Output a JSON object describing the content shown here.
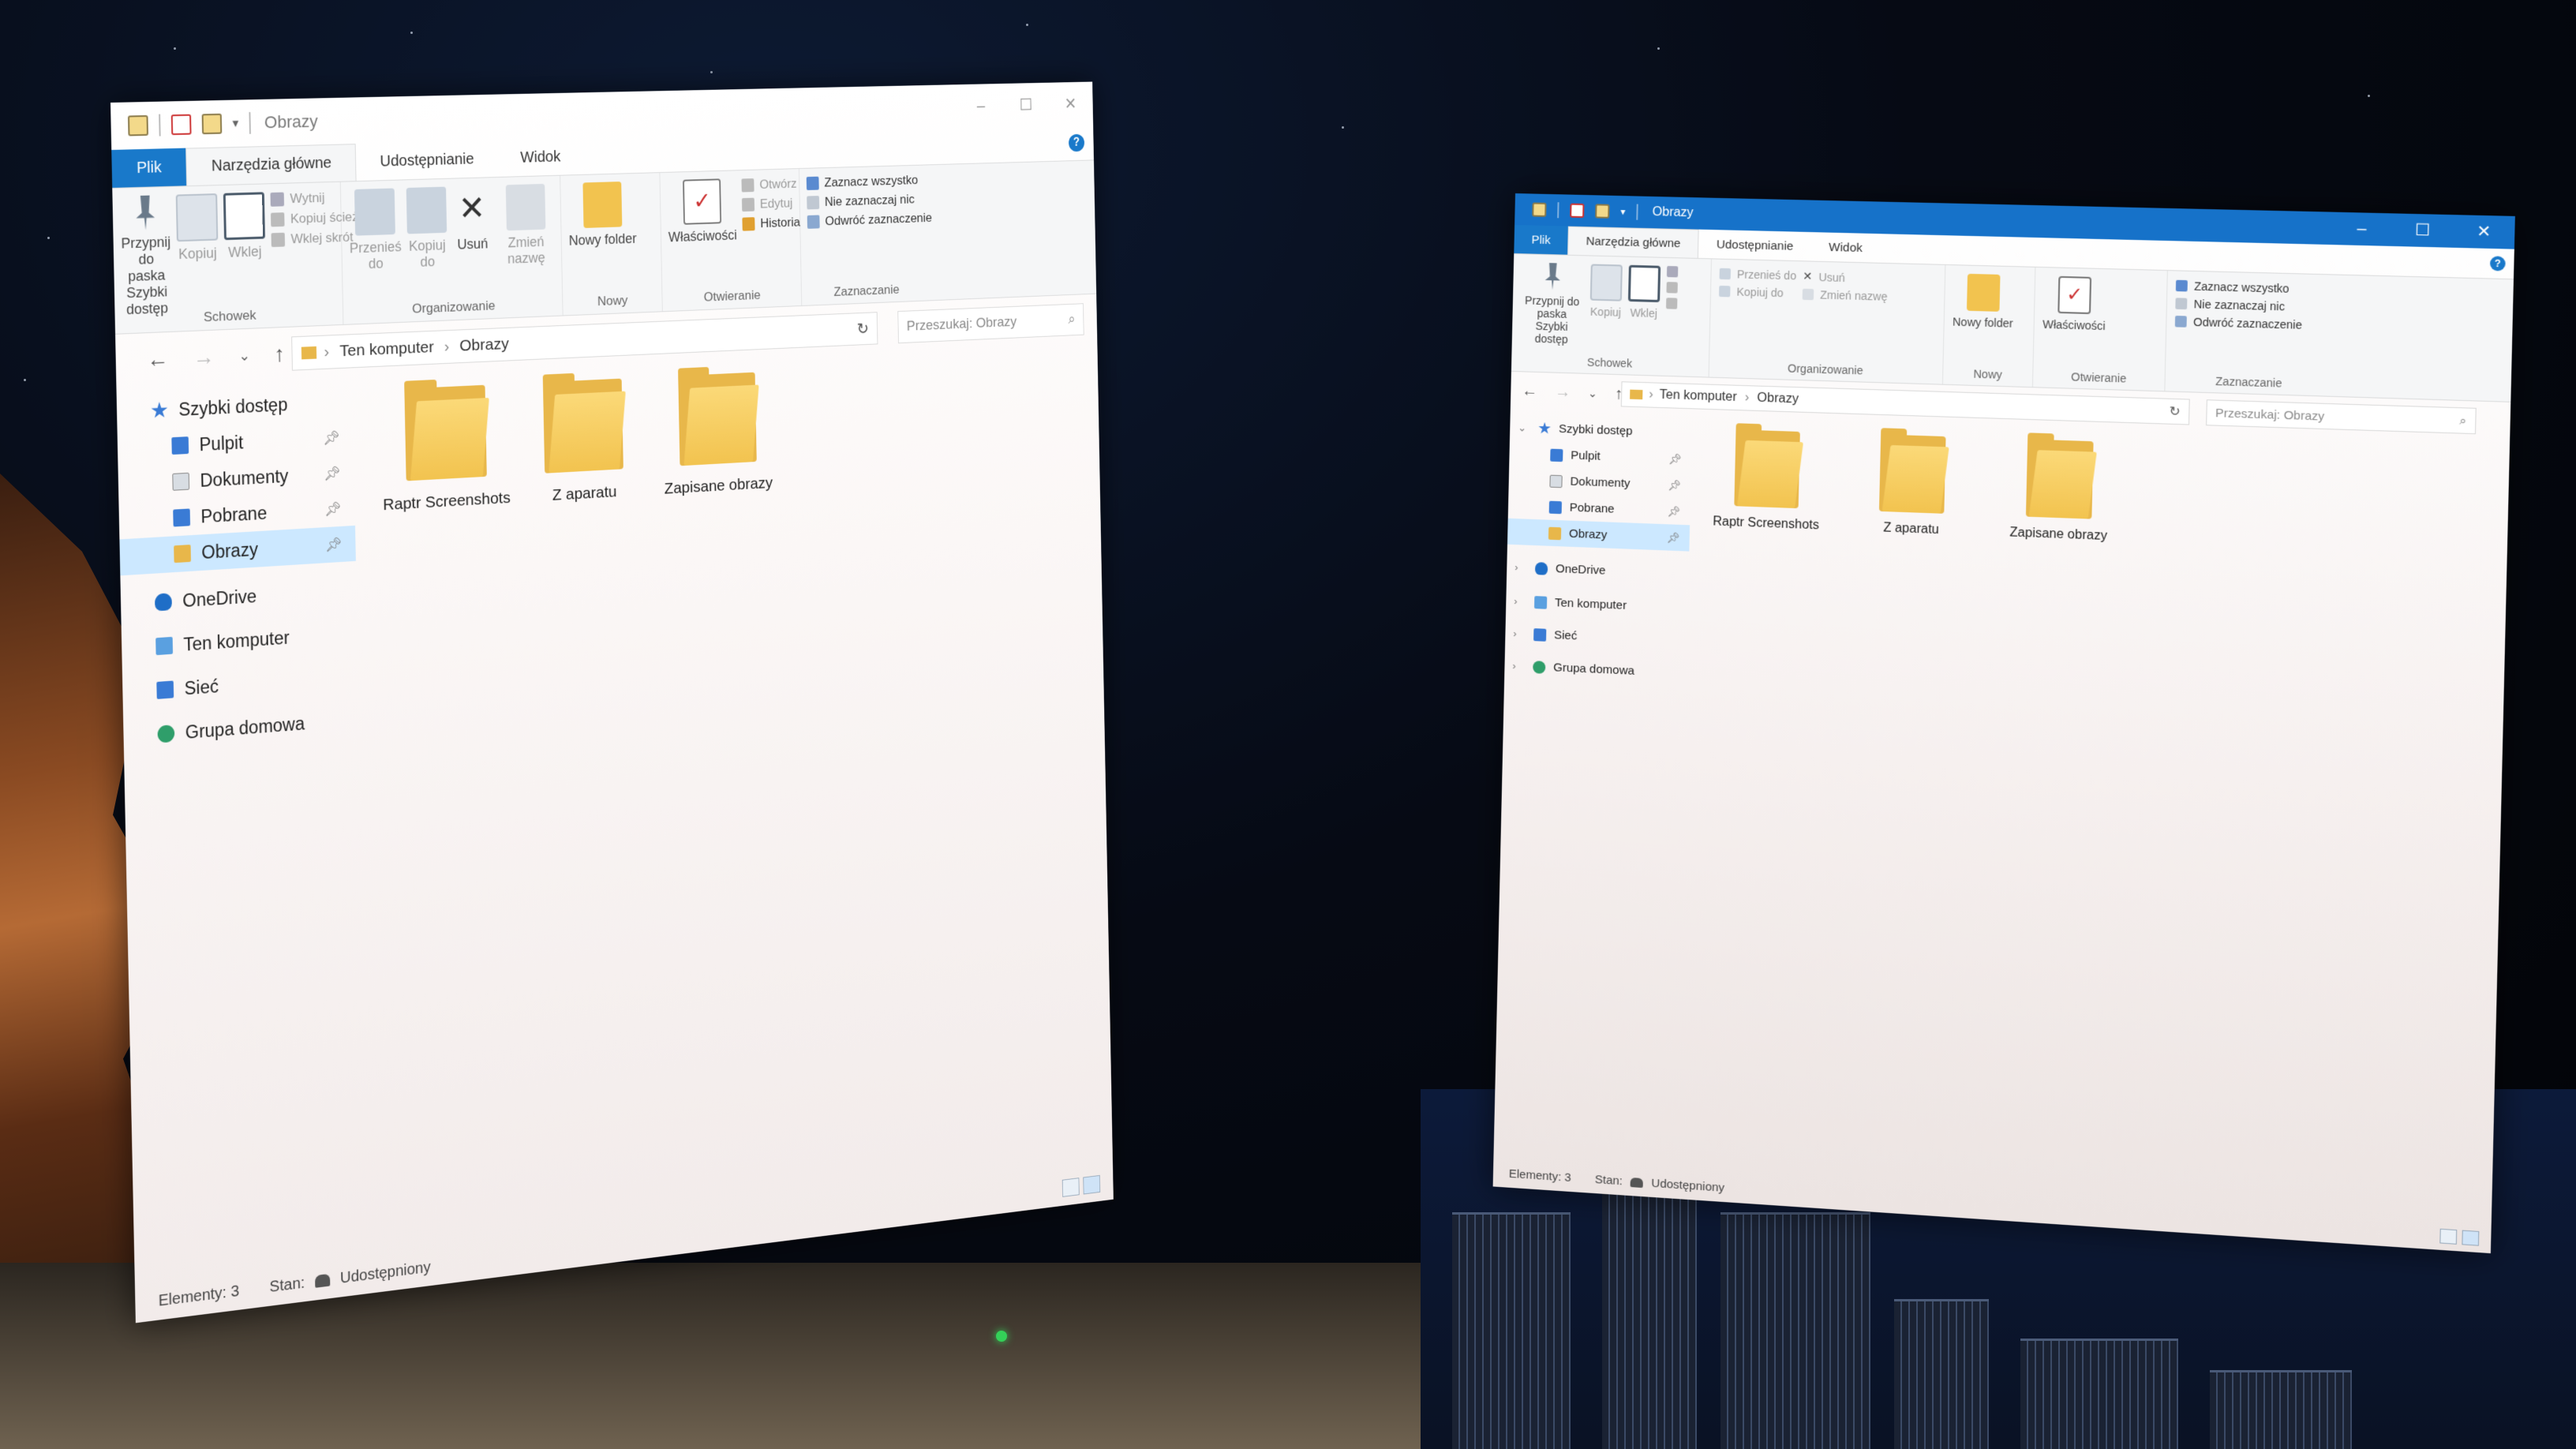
{
  "window": {
    "title": "Obrazy",
    "controls": {
      "minimize": "–",
      "maximize": "☐",
      "close": "✕"
    }
  },
  "tabs": [
    {
      "label": "Plik"
    },
    {
      "label": "Narzędzia główne"
    },
    {
      "label": "Udostępnianie"
    },
    {
      "label": "Widok"
    }
  ],
  "ribbon": {
    "schowek": {
      "name": "Schowek",
      "pin_label": "Przypnij do paska Szybki dostęp",
      "copy_label": "Kopiuj",
      "paste_label": "Wklej",
      "cut_label": "Wytnij",
      "copy_path_label": "Kopiuj ścieżkę",
      "paste_shortcut_label": "Wklej skrót"
    },
    "organizowanie": {
      "name": "Organizowanie",
      "move_label": "Przenieś do",
      "copy_to_label": "Kopiuj do",
      "delete_label": "Usuń",
      "rename_label": "Zmień nazwę"
    },
    "nowy": {
      "name": "Nowy",
      "new_folder_label": "Nowy folder"
    },
    "otwieranie": {
      "name": "Otwieranie",
      "properties_label": "Właściwości",
      "open_label": "Otwórz",
      "edit_label": "Edytuj",
      "history_label": "Historia"
    },
    "zaznaczanie": {
      "name": "Zaznaczanie",
      "select_all_label": "Zaznacz wszystko",
      "select_none_label": "Nie zaznaczaj nic",
      "invert_label": "Odwróć zaznaczenie"
    }
  },
  "address": {
    "crumbs": [
      "Ten komputer",
      "Obrazy"
    ],
    "search_placeholder": "Przeszukaj: Obrazy"
  },
  "nav": {
    "quick_access": "Szybki dostęp",
    "pinned": [
      "Pulpit",
      "Dokumenty",
      "Pobrane",
      "Obrazy"
    ],
    "others": [
      "OneDrive",
      "Ten komputer",
      "Sieć",
      "Grupa domowa"
    ]
  },
  "folders": [
    "Raptr Screenshots",
    "Z aparatu",
    "Zapisane obrazy"
  ],
  "status": {
    "items": "Elementy: 3",
    "state_label": "Stan:",
    "state_value": "Udostępniony"
  },
  "colors": {
    "accent": "#1979ca",
    "folder": "#f2c34f",
    "selection": "#cce8ff"
  }
}
